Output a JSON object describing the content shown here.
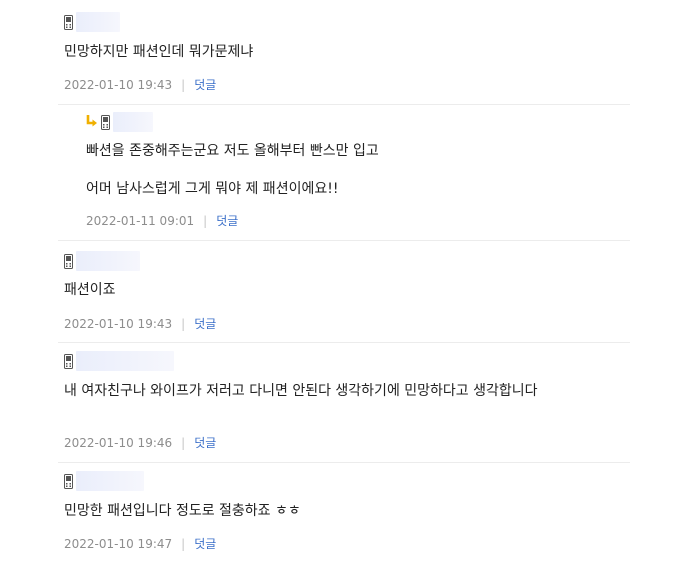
{
  "comments": [
    {
      "text_lines": [
        "민망하지만 패션인데 뭐가문제냐"
      ],
      "date": "2022-01-10 19:43",
      "separator": "|",
      "reply_label": "덧글"
    },
    {
      "text_lines": [
        "빠션을 존중해주는군요 저도 올해부터 빤스만 입고",
        "어머 남사스럽게 그게 뭐야 제 패션이에요!!"
      ],
      "date": "2022-01-11 09:01",
      "separator": "|",
      "reply_label": "덧글"
    },
    {
      "text_lines": [
        "패션이죠"
      ],
      "date": "2022-01-10 19:43",
      "separator": "|",
      "reply_label": "덧글"
    },
    {
      "text_lines": [
        "내 여자친구나 와이프가 저러고 다니면 안된다 생각하기에 민망하다고 생각합니다"
      ],
      "date": "2022-01-10 19:46",
      "separator": "|",
      "reply_label": "덧글"
    },
    {
      "text_lines": [
        "민망한 패션입니다 정도로 절충하죠 ㅎㅎ"
      ],
      "date": "2022-01-10 19:47",
      "separator": "|",
      "reply_label": "덧글"
    }
  ],
  "icons": {
    "mobile": "mobile-phone-icon",
    "reply": "reply-arrow-icon"
  },
  "colors": {
    "date": "#8d8d8d",
    "reply_link": "#3b6fc9",
    "reply_arrow": "#f0b000",
    "separator_line": "#ececec"
  }
}
